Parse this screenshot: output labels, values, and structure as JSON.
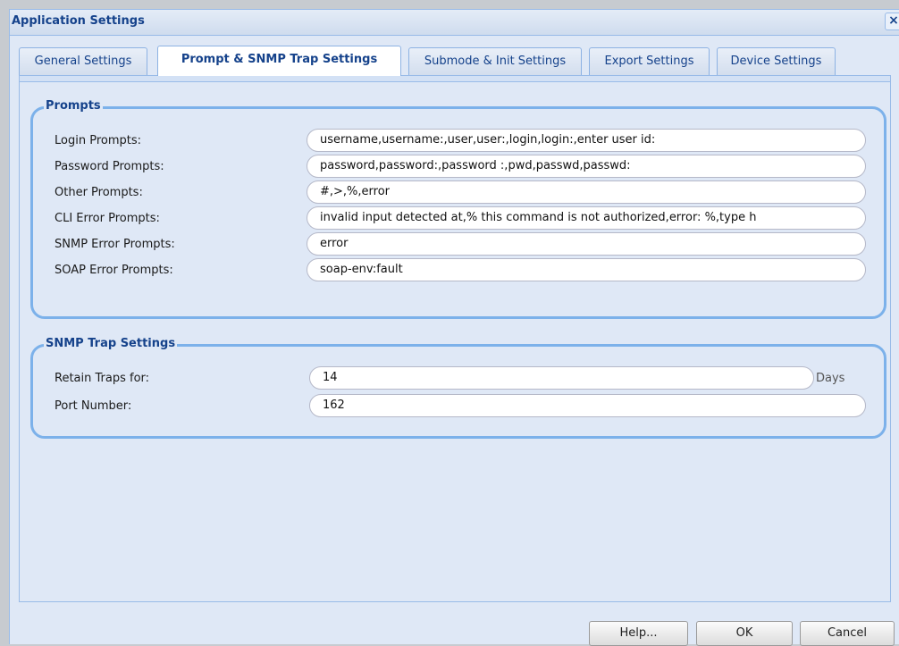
{
  "window": {
    "title": "Application Settings",
    "close_glyph": "×"
  },
  "tabs": [
    {
      "label": "General Settings"
    },
    {
      "label": "Prompt & SNMP Trap Settings",
      "active": true
    },
    {
      "label": "Submode & Init Settings"
    },
    {
      "label": "Export Settings"
    },
    {
      "label": "Device Settings"
    }
  ],
  "prompts": {
    "legend": "Prompts",
    "fields": [
      {
        "label": "Login Prompts:",
        "value": "username,username:,user,user:,login,login:,enter user id:"
      },
      {
        "label": "Password Prompts:",
        "value": "password,password:,password :,pwd,passwd,passwd:"
      },
      {
        "label": "Other Prompts:",
        "value": "#,>,%,error"
      },
      {
        "label": "CLI Error Prompts:",
        "value": "invalid input detected at,% this command is not authorized,error: %,type h"
      },
      {
        "label": "SNMP Error Prompts:",
        "value": "error"
      },
      {
        "label": "SOAP Error Prompts:",
        "value": "soap-env:fault"
      }
    ]
  },
  "snmp": {
    "legend": "SNMP Trap Settings",
    "retain": {
      "label": "Retain Traps for:",
      "value": "14",
      "unit": "Days"
    },
    "port": {
      "label": "Port Number:",
      "value": "162"
    }
  },
  "buttons": {
    "help": "Help...",
    "ok": "OK",
    "cancel": "Cancel"
  },
  "colors": {
    "accent": "#15428b",
    "border": "#7cb1ea",
    "panel_bg": "#dfe8f6"
  }
}
